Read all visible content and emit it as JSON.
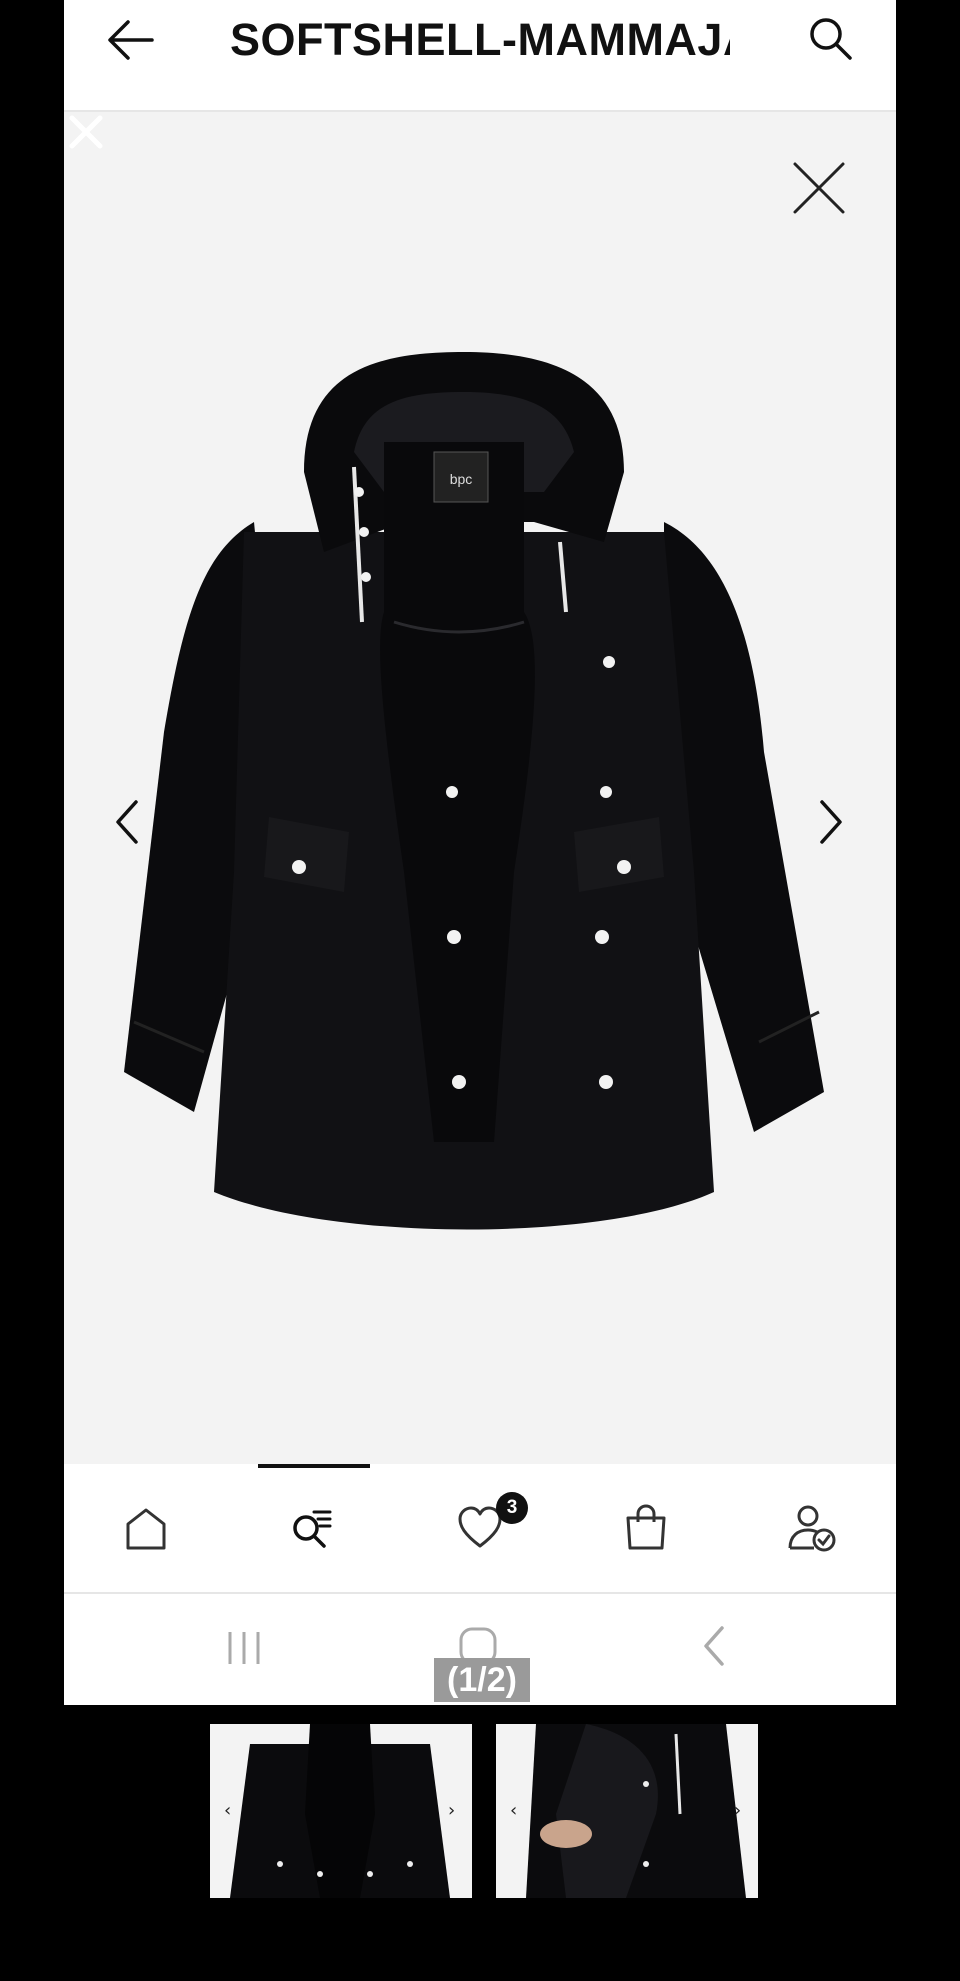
{
  "header": {
    "title": "SOFTSHELL-MAMMAJA..."
  },
  "icons": {
    "back": "arrow-left-icon",
    "search": "search-icon",
    "close": "close-icon",
    "prev": "chevron-left-icon",
    "next": "chevron-right-icon"
  },
  "viewer": {
    "counter": "(1/2)",
    "brand_label": "bpc"
  },
  "bottom_nav": {
    "items": [
      {
        "name": "home",
        "icon": "home-icon"
      },
      {
        "name": "search",
        "icon": "search-list-icon",
        "active": true
      },
      {
        "name": "wishlist",
        "icon": "heart-icon",
        "badge": "3"
      },
      {
        "name": "cart",
        "icon": "shopping-bag-icon"
      },
      {
        "name": "account",
        "icon": "user-check-icon"
      }
    ]
  },
  "colors": {
    "accent": "#111111",
    "viewer_bg": "#f3f3f3",
    "garment": "#0b0b0d"
  }
}
